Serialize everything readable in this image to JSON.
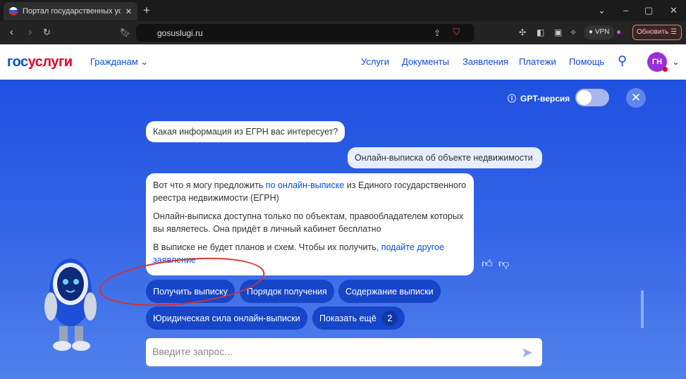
{
  "browser": {
    "tab_title": "Портал государственных услуг",
    "url": "gosuslugi.ru",
    "vpn_label": "VPN",
    "update_label": "Обновить"
  },
  "site": {
    "logo_part1": "гос",
    "logo_part2": "услуги",
    "audience": "Гражданам",
    "menu": [
      "Услуги",
      "Документы",
      "Заявления",
      "Платежи",
      "Помощь"
    ],
    "avatar_initials": "ГН"
  },
  "chat": {
    "gpt_label": "GPT-версия",
    "gpt_enabled": false,
    "bot_question": "Какая информация из ЕГРН вас интересует?",
    "user_reply": "Онлайн-выписка об объекте недвижимости",
    "answer": {
      "p1_before": "Вот что я могу предложить ",
      "p1_link": "по онлайн-выписке",
      "p1_after": " из Единого государственного реестра недвижимости (ЕГРН)",
      "p2": "Онлайн-выписка доступна только по объектам, правообладателем которых вы являетесь. Она придёт в личный кабинет бесплатно",
      "p3_before": "В выписке не будет планов и схем. Чтобы их получить, ",
      "p3_link": "подайте другое заявление"
    },
    "suggestions": [
      "Получить выписку",
      "Порядок получения",
      "Содержание выписки",
      "Юридическая сила онлайн-выписки"
    ],
    "show_more_label": "Показать ещё",
    "show_more_count": "2",
    "input_placeholder": "Введите запрос..."
  }
}
